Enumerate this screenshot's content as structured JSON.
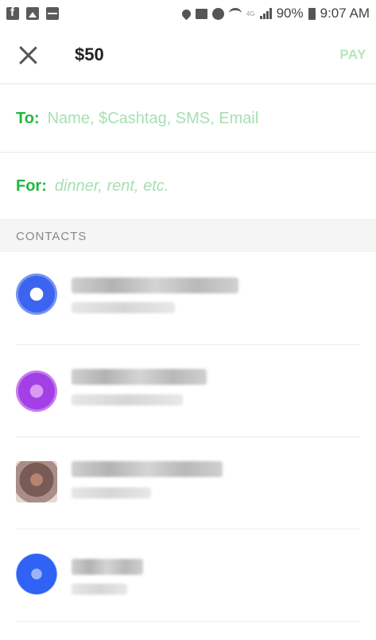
{
  "status_bar": {
    "battery": "90%",
    "time": "9:07 AM",
    "network": "4G",
    "left_icons": [
      "facebook-icon",
      "image-icon",
      "activity-icon"
    ],
    "right_icons": [
      "location-icon",
      "vibrate-mute-icon",
      "alarm-icon",
      "wifi-icon",
      "signal-icon",
      "battery-icon"
    ]
  },
  "header": {
    "amount": "$50",
    "pay_label": "PAY",
    "close_icon": "close-icon"
  },
  "to_field": {
    "label": "To:",
    "placeholder": "Name, $Cashtag, SMS, Email"
  },
  "for_field": {
    "label": "For:",
    "placeholder": "dinner, rent, etc."
  },
  "contacts": {
    "header": "CONTACTS",
    "avatar_colors": [
      "#3b64f0",
      "#a240e6",
      "#7a5a54",
      "#2f62f5"
    ]
  }
}
